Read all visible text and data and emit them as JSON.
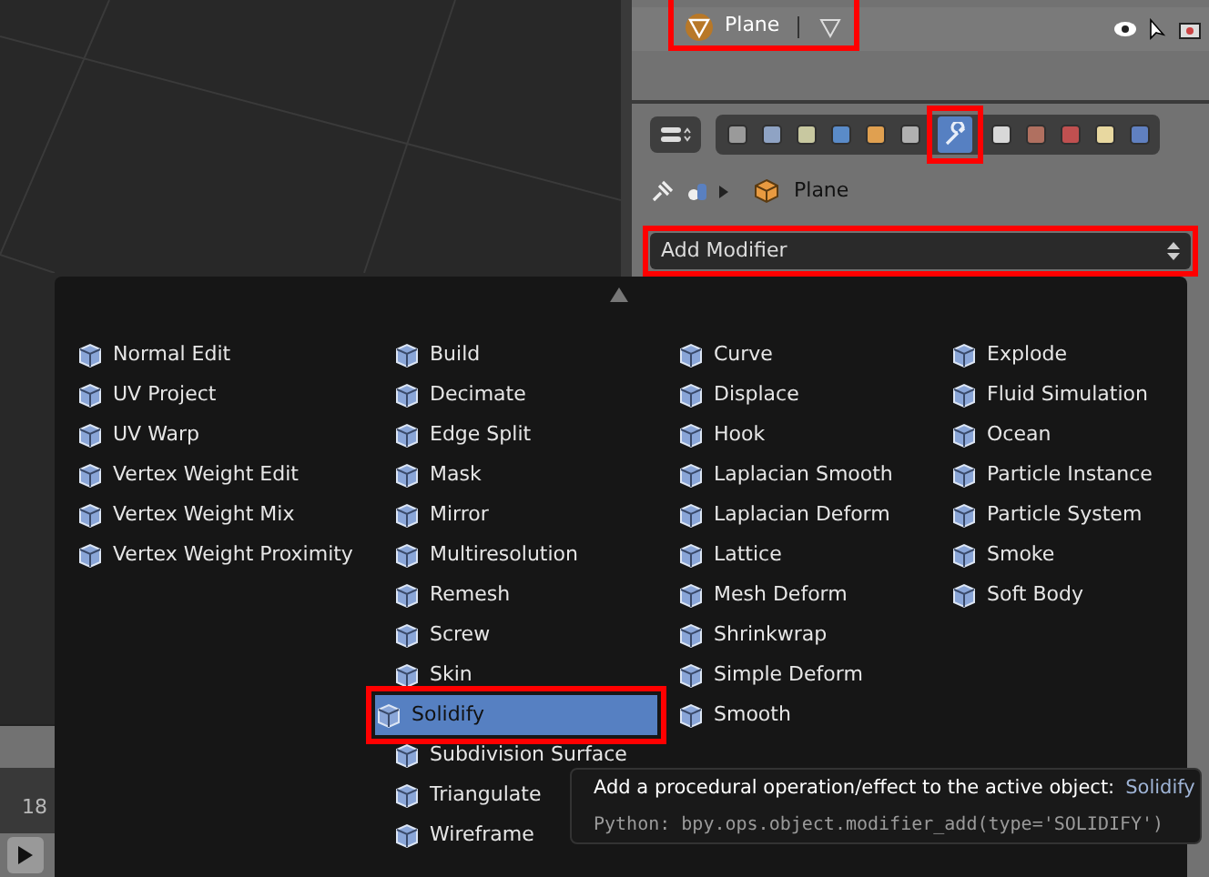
{
  "outliner": {
    "object_name": "Plane"
  },
  "properties": {
    "tabs": [
      {
        "kind": "render",
        "selected": false
      },
      {
        "kind": "layers",
        "selected": false
      },
      {
        "kind": "scene",
        "selected": false
      },
      {
        "kind": "world",
        "selected": false
      },
      {
        "kind": "object",
        "selected": false
      },
      {
        "kind": "constraints",
        "selected": false
      },
      {
        "kind": "modifiers",
        "selected": true
      },
      {
        "kind": "data",
        "selected": false
      },
      {
        "kind": "material",
        "selected": false
      },
      {
        "kind": "texture",
        "selected": false
      },
      {
        "kind": "particles",
        "selected": false
      },
      {
        "kind": "physics",
        "selected": false
      }
    ],
    "breadcrumb": "Plane",
    "dropdown": "Add Modifier"
  },
  "timeline": {
    "ticks": [
      "18"
    ]
  },
  "menu": {
    "columns": [
      [
        {
          "label": "Normal Edit",
          "selected": false
        },
        {
          "label": "UV Project",
          "selected": false
        },
        {
          "label": "UV Warp",
          "selected": false
        },
        {
          "label": "Vertex Weight Edit",
          "selected": false
        },
        {
          "label": "Vertex Weight Mix",
          "selected": false
        },
        {
          "label": "Vertex Weight Proximity",
          "selected": false
        }
      ],
      [
        {
          "label": "Build",
          "selected": false
        },
        {
          "label": "Decimate",
          "selected": false
        },
        {
          "label": "Edge Split",
          "selected": false
        },
        {
          "label": "Mask",
          "selected": false
        },
        {
          "label": "Mirror",
          "selected": false
        },
        {
          "label": "Multiresolution",
          "selected": false
        },
        {
          "label": "Remesh",
          "selected": false
        },
        {
          "label": "Screw",
          "selected": false
        },
        {
          "label": "Skin",
          "selected": false
        },
        {
          "label": "Solidify",
          "selected": true
        },
        {
          "label": "Subdivision Surface",
          "selected": false
        },
        {
          "label": "Triangulate",
          "selected": false
        },
        {
          "label": "Wireframe",
          "selected": false
        }
      ],
      [
        {
          "label": "Curve",
          "selected": false
        },
        {
          "label": "Displace",
          "selected": false
        },
        {
          "label": "Hook",
          "selected": false
        },
        {
          "label": "Laplacian Smooth",
          "selected": false
        },
        {
          "label": "Laplacian Deform",
          "selected": false
        },
        {
          "label": "Lattice",
          "selected": false
        },
        {
          "label": "Mesh Deform",
          "selected": false
        },
        {
          "label": "Shrinkwrap",
          "selected": false
        },
        {
          "label": "Simple Deform",
          "selected": false
        },
        {
          "label": "Smooth",
          "selected": false
        }
      ],
      [
        {
          "label": "Explode",
          "selected": false
        },
        {
          "label": "Fluid Simulation",
          "selected": false
        },
        {
          "label": "Ocean",
          "selected": false
        },
        {
          "label": "Particle Instance",
          "selected": false
        },
        {
          "label": "Particle System",
          "selected": false
        },
        {
          "label": "Smoke",
          "selected": false
        },
        {
          "label": "Soft Body",
          "selected": false
        }
      ]
    ]
  },
  "tooltip": {
    "description": "Add a procedural operation/effect to the active object:",
    "value": "Solidify",
    "python": "Python: bpy.ops.object.modifier_add(type='SOLIDIFY')"
  }
}
